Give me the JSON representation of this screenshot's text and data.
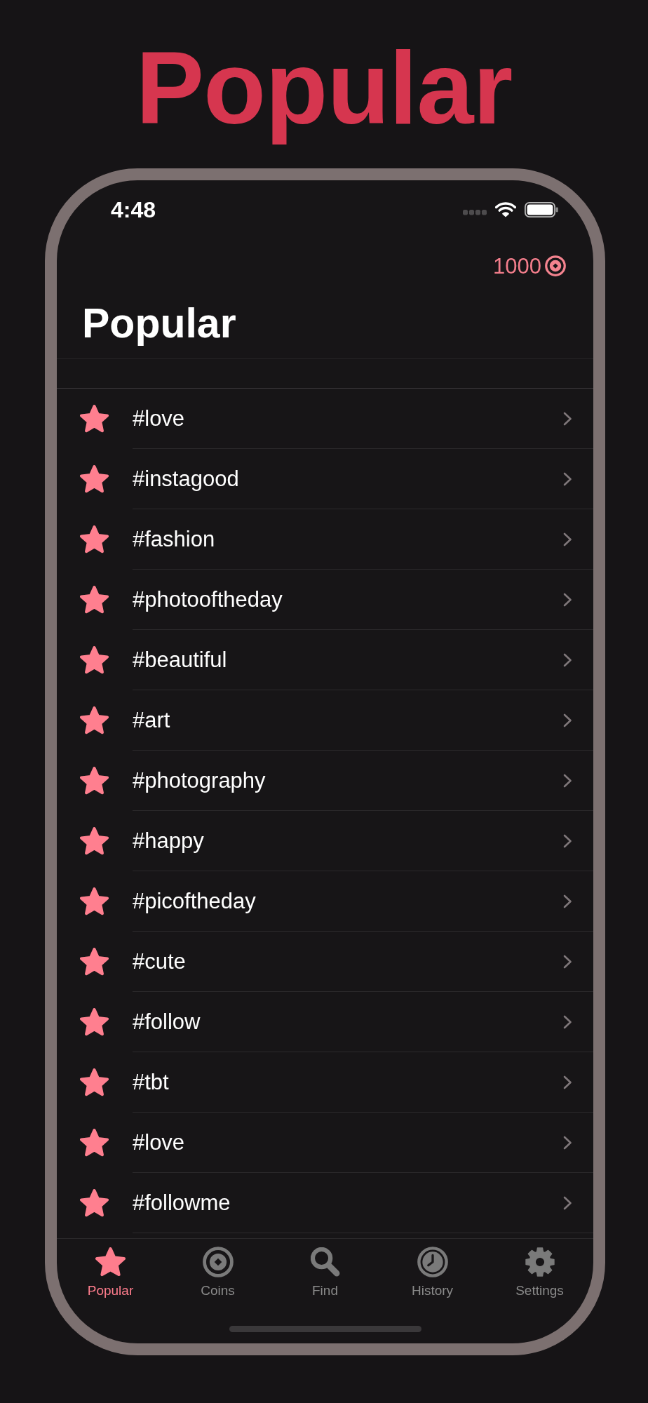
{
  "header": {
    "title": "Popular"
  },
  "status_bar": {
    "time": "4:48"
  },
  "nav_bar": {
    "coins": "1000",
    "title": "Popular"
  },
  "list": {
    "items": [
      {
        "label": "#love"
      },
      {
        "label": "#instagood"
      },
      {
        "label": "#fashion"
      },
      {
        "label": "#photooftheday"
      },
      {
        "label": "#beautiful"
      },
      {
        "label": "#art"
      },
      {
        "label": "#photography"
      },
      {
        "label": "#happy"
      },
      {
        "label": "#picoftheday"
      },
      {
        "label": "#cute"
      },
      {
        "label": "#follow"
      },
      {
        "label": "#tbt"
      },
      {
        "label": "#love"
      },
      {
        "label": "#followme"
      }
    ]
  },
  "tab_bar": {
    "tabs": [
      {
        "label": "Popular",
        "selected": true
      },
      {
        "label": "Coins",
        "selected": false
      },
      {
        "label": "Find",
        "selected": false
      },
      {
        "label": "History",
        "selected": false
      },
      {
        "label": "Settings",
        "selected": false
      }
    ]
  }
}
